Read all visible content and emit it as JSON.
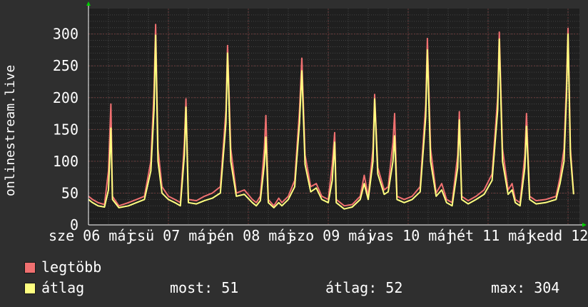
{
  "chart_data": {
    "type": "area",
    "ylabel": "onlinestream.live",
    "ylim": [
      0,
      340
    ],
    "yticks": [
      0,
      50,
      100,
      150,
      200,
      250,
      300
    ],
    "grid": true,
    "xticks": [
      {
        "label": "sze 06 máj",
        "day": 0
      },
      {
        "label": "csü 07 máj",
        "day": 1
      },
      {
        "label": "pén 08 máj",
        "day": 2
      },
      {
        "label": "szo 09 máj",
        "day": 3
      },
      {
        "label": "vas 10 máj",
        "day": 4
      },
      {
        "label": "hét 11 máj",
        "day": 5
      },
      {
        "label": "kedd 12 máj",
        "day": 6
      }
    ],
    "series": [
      {
        "name": "legtöbb",
        "color": "#f07070",
        "points": [
          [
            0.0,
            45
          ],
          [
            0.05,
            40
          ],
          [
            0.12,
            35
          ],
          [
            0.2,
            32
          ],
          [
            0.25,
            85
          ],
          [
            0.28,
            190
          ],
          [
            0.3,
            45
          ],
          [
            0.38,
            30
          ],
          [
            0.5,
            35
          ],
          [
            0.6,
            40
          ],
          [
            0.7,
            45
          ],
          [
            0.78,
            100
          ],
          [
            0.82,
            210
          ],
          [
            0.84,
            315
          ],
          [
            0.87,
            120
          ],
          [
            0.92,
            60
          ],
          [
            1.0,
            45
          ],
          [
            1.08,
            40
          ],
          [
            1.15,
            35
          ],
          [
            1.2,
            130
          ],
          [
            1.22,
            198
          ],
          [
            1.25,
            40
          ],
          [
            1.35,
            38
          ],
          [
            1.45,
            45
          ],
          [
            1.55,
            50
          ],
          [
            1.65,
            60
          ],
          [
            1.72,
            180
          ],
          [
            1.74,
            282
          ],
          [
            1.78,
            120
          ],
          [
            1.85,
            50
          ],
          [
            1.95,
            55
          ],
          [
            2.05,
            40
          ],
          [
            2.1,
            35
          ],
          [
            2.15,
            45
          ],
          [
            2.2,
            120
          ],
          [
            2.22,
            172
          ],
          [
            2.25,
            40
          ],
          [
            2.32,
            30
          ],
          [
            2.38,
            42
          ],
          [
            2.42,
            35
          ],
          [
            2.5,
            45
          ],
          [
            2.58,
            70
          ],
          [
            2.64,
            180
          ],
          [
            2.67,
            262
          ],
          [
            2.71,
            110
          ],
          [
            2.78,
            60
          ],
          [
            2.85,
            65
          ],
          [
            2.92,
            45
          ],
          [
            3.0,
            40
          ],
          [
            3.05,
            95
          ],
          [
            3.08,
            145
          ],
          [
            3.1,
            40
          ],
          [
            3.2,
            30
          ],
          [
            3.3,
            32
          ],
          [
            3.4,
            45
          ],
          [
            3.45,
            78
          ],
          [
            3.5,
            45
          ],
          [
            3.56,
            120
          ],
          [
            3.58,
            205
          ],
          [
            3.62,
            90
          ],
          [
            3.7,
            55
          ],
          [
            3.75,
            60
          ],
          [
            3.81,
            130
          ],
          [
            3.83,
            175
          ],
          [
            3.86,
            45
          ],
          [
            3.95,
            40
          ],
          [
            4.05,
            45
          ],
          [
            4.15,
            60
          ],
          [
            4.22,
            190
          ],
          [
            4.24,
            293
          ],
          [
            4.28,
            120
          ],
          [
            4.35,
            50
          ],
          [
            4.42,
            65
          ],
          [
            4.48,
            40
          ],
          [
            4.55,
            35
          ],
          [
            4.62,
            110
          ],
          [
            4.64,
            178
          ],
          [
            4.67,
            45
          ],
          [
            4.75,
            38
          ],
          [
            4.85,
            45
          ],
          [
            4.95,
            55
          ],
          [
            5.05,
            80
          ],
          [
            5.12,
            200
          ],
          [
            5.14,
            303
          ],
          [
            5.18,
            120
          ],
          [
            5.25,
            55
          ],
          [
            5.3,
            65
          ],
          [
            5.34,
            40
          ],
          [
            5.4,
            35
          ],
          [
            5.46,
            110
          ],
          [
            5.48,
            175
          ],
          [
            5.52,
            45
          ],
          [
            5.6,
            38
          ],
          [
            5.72,
            40
          ],
          [
            5.85,
            45
          ],
          [
            5.9,
            75
          ],
          [
            5.95,
            120
          ],
          [
            5.98,
            220
          ],
          [
            6.0,
            309
          ],
          [
            6.03,
            120
          ],
          [
            6.07,
            50
          ]
        ]
      },
      {
        "name": "átlag",
        "color": "#ffff80",
        "points": [
          [
            0.0,
            40
          ],
          [
            0.05,
            35
          ],
          [
            0.12,
            30
          ],
          [
            0.2,
            28
          ],
          [
            0.25,
            55
          ],
          [
            0.28,
            152
          ],
          [
            0.3,
            40
          ],
          [
            0.38,
            27
          ],
          [
            0.5,
            30
          ],
          [
            0.6,
            35
          ],
          [
            0.7,
            40
          ],
          [
            0.78,
            85
          ],
          [
            0.82,
            180
          ],
          [
            0.84,
            298
          ],
          [
            0.87,
            100
          ],
          [
            0.92,
            50
          ],
          [
            1.0,
            40
          ],
          [
            1.08,
            35
          ],
          [
            1.15,
            30
          ],
          [
            1.2,
            110
          ],
          [
            1.22,
            185
          ],
          [
            1.25,
            35
          ],
          [
            1.35,
            33
          ],
          [
            1.45,
            38
          ],
          [
            1.55,
            42
          ],
          [
            1.65,
            50
          ],
          [
            1.72,
            160
          ],
          [
            1.74,
            270
          ],
          [
            1.78,
            100
          ],
          [
            1.85,
            45
          ],
          [
            1.95,
            48
          ],
          [
            2.05,
            35
          ],
          [
            2.1,
            30
          ],
          [
            2.15,
            38
          ],
          [
            2.2,
            95
          ],
          [
            2.22,
            138
          ],
          [
            2.25,
            35
          ],
          [
            2.32,
            27
          ],
          [
            2.38,
            35
          ],
          [
            2.42,
            30
          ],
          [
            2.5,
            40
          ],
          [
            2.58,
            60
          ],
          [
            2.64,
            160
          ],
          [
            2.67,
            242
          ],
          [
            2.71,
            95
          ],
          [
            2.78,
            52
          ],
          [
            2.85,
            58
          ],
          [
            2.92,
            40
          ],
          [
            3.0,
            35
          ],
          [
            3.05,
            70
          ],
          [
            3.08,
            130
          ],
          [
            3.1,
            35
          ],
          [
            3.2,
            25
          ],
          [
            3.3,
            28
          ],
          [
            3.4,
            40
          ],
          [
            3.45,
            65
          ],
          [
            3.5,
            40
          ],
          [
            3.56,
            100
          ],
          [
            3.58,
            198
          ],
          [
            3.62,
            80
          ],
          [
            3.7,
            48
          ],
          [
            3.75,
            52
          ],
          [
            3.81,
            100
          ],
          [
            3.83,
            140
          ],
          [
            3.86,
            40
          ],
          [
            3.95,
            35
          ],
          [
            4.05,
            40
          ],
          [
            4.15,
            52
          ],
          [
            4.22,
            170
          ],
          [
            4.24,
            275
          ],
          [
            4.28,
            100
          ],
          [
            4.35,
            45
          ],
          [
            4.42,
            55
          ],
          [
            4.48,
            35
          ],
          [
            4.55,
            30
          ],
          [
            4.62,
            90
          ],
          [
            4.64,
            165
          ],
          [
            4.67,
            40
          ],
          [
            4.75,
            33
          ],
          [
            4.85,
            40
          ],
          [
            4.95,
            48
          ],
          [
            5.05,
            70
          ],
          [
            5.12,
            180
          ],
          [
            5.14,
            292
          ],
          [
            5.18,
            100
          ],
          [
            5.25,
            48
          ],
          [
            5.3,
            55
          ],
          [
            5.34,
            35
          ],
          [
            5.4,
            30
          ],
          [
            5.46,
            90
          ],
          [
            5.48,
            155
          ],
          [
            5.52,
            40
          ],
          [
            5.6,
            33
          ],
          [
            5.72,
            35
          ],
          [
            5.85,
            40
          ],
          [
            5.9,
            65
          ],
          [
            5.95,
            100
          ],
          [
            5.98,
            200
          ],
          [
            6.0,
            300
          ],
          [
            6.03,
            110
          ],
          [
            6.07,
            48
          ]
        ]
      }
    ]
  },
  "legend": {
    "max_label": "legtöbb",
    "avg_label": "átlag",
    "max_color": "#f07070",
    "avg_color": "#ffff80"
  },
  "stats": {
    "now": "most: 51",
    "avg": "átlag: 52",
    "max": "max: 304"
  }
}
